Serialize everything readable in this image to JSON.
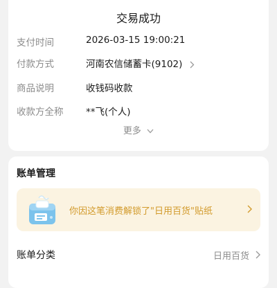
{
  "transaction": {
    "status_title": "交易成功",
    "details": [
      {
        "label": "支付时间",
        "value": "2026-03-15 19:00:21"
      },
      {
        "label": "付款方式",
        "value": "河南农信储蓄卡(9102)"
      },
      {
        "label": "商品说明",
        "value": "收钱码收款"
      },
      {
        "label": "收款方全称",
        "value": "**飞(个人)"
      }
    ],
    "more_label": "更多"
  },
  "bill": {
    "section_title": "账单管理",
    "sticker_text": "你因这笔消费解锁了\"日用百货\"贴纸",
    "category_label": "账单分类",
    "category_value": "日用百货"
  },
  "colors": {
    "background": "#f2f2f2",
    "card": "#ffffff",
    "muted_text": "#8c8c8c",
    "sticker_bg": "#fbf3e1",
    "sticker_text": "#d29a2b"
  },
  "icons": [
    "chevron-right-icon",
    "chevron-down-icon",
    "sticker-box-icon"
  ]
}
